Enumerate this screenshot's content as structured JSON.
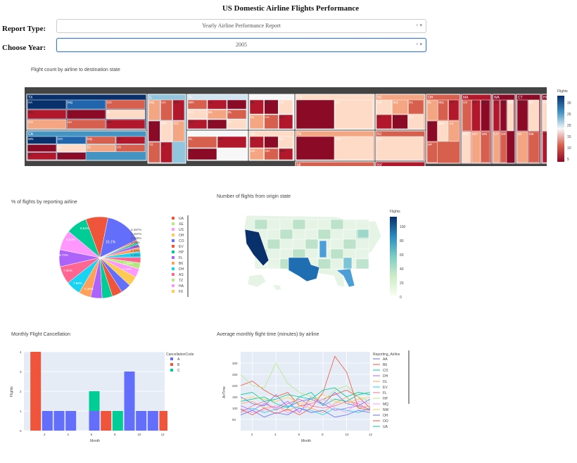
{
  "page": {
    "title": "US Domestic Airline Flights Performance"
  },
  "form": {
    "report_type_label": "Report Type:",
    "report_type_value": "Yearly Airline Performance Report",
    "choose_year_label": "Choose Year:",
    "choose_year_value": "2005",
    "clear_glyph": "×",
    "arrow_glyph": "▾"
  },
  "colors": {
    "accent": "#3a7fd5",
    "bar_a": "#636efa",
    "bar_b": "#ef553b",
    "bar_c": "#00cc96",
    "plot_bg": "#e5ecf6"
  },
  "icons": [
    "clear-icon",
    "chevron-down-icon"
  ],
  "chart_data": [
    {
      "type": "treemap",
      "title": "Flight count by airline to destination state",
      "colorbar_title": "Flights",
      "colorbar_ticks": [
        "30",
        "25",
        "20",
        "15",
        "10",
        "5"
      ],
      "nodes": [
        {
          "state": "TX",
          "airlines": [
            "AA",
            "MQ",
            "CO",
            "WN",
            "XE",
            "DL",
            "OO",
            "UA",
            "HP"
          ]
        },
        {
          "state": "CA",
          "airlines": [
            "WN",
            "OO",
            "MQ",
            "HP",
            "AA",
            "UA",
            "DL",
            "AS",
            "B6",
            "CO"
          ]
        },
        {
          "state": "IL",
          "airlines": [
            "MQ",
            "UA",
            "WN",
            "AA",
            "NW",
            "OO",
            "TZ",
            "FL"
          ]
        },
        {
          "state": "FL",
          "airlines": [
            "WN",
            "AA",
            "EV",
            "CO",
            "B6",
            "DL",
            "OH",
            "US",
            "FL"
          ]
        },
        {
          "state": "GA",
          "airlines": [
            "DL",
            "EV",
            "FL"
          ]
        },
        {
          "state": "NY",
          "airlines": [
            "B6",
            "MQ",
            "OH",
            "DL",
            "AA",
            "US"
          ]
        },
        {
          "state": "VA",
          "airlines": [
            "UA",
            "AA",
            "DL",
            "US",
            "OH",
            "NW"
          ]
        },
        {
          "state": "CO",
          "airlines": [
            "OO",
            "UA"
          ]
        },
        {
          "state": "PA",
          "airlines": [
            "US",
            "FW"
          ]
        },
        {
          "state": "MI",
          "airlines": [
            "NW",
            "OH"
          ]
        },
        {
          "state": "KY",
          "airlines": [
            "OH",
            "DL"
          ]
        },
        {
          "state": "NC",
          "airlines": [
            "US",
            "MQ",
            "DL",
            "EV",
            "OH",
            "AA"
          ]
        },
        {
          "state": "NJ",
          "airlines": [
            "CO"
          ]
        },
        {
          "state": "NV",
          "airlines": [
            "WN",
            "HP",
            "AA"
          ]
        },
        {
          "state": "UT",
          "airlines": [
            "DO",
            "WN",
            "EV",
            "DL"
          ]
        },
        {
          "state": "OH",
          "airlines": [
            "DL",
            "MQ",
            "TN",
            "NW",
            "WN",
            "AZ",
            "HP"
          ]
        },
        {
          "state": "MA",
          "airlines": [
            "US",
            "AA",
            "MN",
            "NW",
            "MO",
            "WN"
          ]
        },
        {
          "state": "WA",
          "airlines": [
            "AS",
            "WN",
            "MD",
            "LA",
            "OR"
          ]
        },
        {
          "state": "CT",
          "airlines": [
            "NM",
            "SC",
            "WI",
            "ME"
          ]
        },
        {
          "state": "HI",
          "airlines": [
            "HA",
            "AK",
            "NE",
            "IA",
            "MT"
          ]
        },
        {
          "state": "AL",
          "airlines": [
            "AR",
            "IN",
            "PR",
            "RI",
            "WY"
          ]
        }
      ]
    },
    {
      "type": "pie",
      "title": "% of flights by reporting airline",
      "labels": [
        "UA",
        "XE",
        "US",
        "OH",
        "CO",
        "EV",
        "HP",
        "FL",
        "B6",
        "DH",
        "AS",
        "TZ",
        "HA",
        "F9"
      ],
      "slice_labels": [
        "16.1%",
        "8.72%",
        "7.36%",
        "7.66%",
        "6.36%",
        "9.03%",
        "9.64%",
        "2.39%",
        "2.39%",
        "1.89%",
        "1.49%",
        "0.895%",
        "0.497%",
        "0.497%",
        "2.58%",
        "3.78%",
        "4.37%",
        "4.37%",
        "4.47%",
        "4.47%",
        "4.97%",
        "5.27%"
      ],
      "values": [
        16.1,
        0.497,
        0.497,
        0.895,
        1.49,
        1.89,
        2.39,
        2.39,
        2.58,
        3.78,
        4.37,
        4.37,
        4.47,
        4.47,
        4.97,
        5.27,
        6.36,
        7.66,
        7.36,
        8.72,
        9.03,
        9.64
      ]
    },
    {
      "type": "choropleth",
      "title": "Number of flights from origin state",
      "colorbar_title": "Flights",
      "colorbar_ticks": [
        "100",
        "80",
        "60",
        "40",
        "20",
        "0"
      ],
      "highlighted": {
        "CA": 100,
        "TX": 95,
        "IL": 55,
        "FL": 60,
        "GA": 40,
        "NY": 35
      }
    },
    {
      "type": "bar",
      "title": "Monthly Flight Cancellation",
      "xlabel": "Month",
      "ylabel": "Flights",
      "x_ticks": [
        "2",
        "4",
        "6",
        "8",
        "10",
        "12"
      ],
      "y_ticks": [
        "0",
        "1",
        "2",
        "3",
        "4"
      ],
      "ylim": [
        0,
        4
      ],
      "legend_title": "CancellationCode",
      "series": [
        {
          "name": "A",
          "values": [
            {
              "x": 2,
              "y": 1
            },
            {
              "x": 3,
              "y": 1
            },
            {
              "x": 4,
              "y": 1
            },
            {
              "x": 6,
              "y": 1
            },
            {
              "x": 9,
              "y": 3
            },
            {
              "x": 10,
              "y": 1
            },
            {
              "x": 11,
              "y": 1
            }
          ]
        },
        {
          "name": "B",
          "values": [
            {
              "x": 1,
              "y": 4
            },
            {
              "x": 7,
              "y": 1
            },
            {
              "x": 12,
              "y": 1
            }
          ]
        },
        {
          "name": "C",
          "values": [
            {
              "x": 6,
              "y": 1
            },
            {
              "x": 8,
              "y": 1
            }
          ]
        }
      ]
    },
    {
      "type": "line",
      "title": "Average monthly flight time (minutes) by airline",
      "xlabel": "Month",
      "ylabel": "AirTime",
      "x_ticks": [
        "2",
        "4",
        "6",
        "8",
        "10",
        "12"
      ],
      "y_ticks": [
        "300",
        "250",
        "200",
        "150",
        "100",
        "50"
      ],
      "legend_title": "Reporting_Airline",
      "series": [
        {
          "name": "AA",
          "values": [
            150,
            120,
            110,
            160,
            105,
            130,
            140,
            115,
            170,
            120,
            110,
            140
          ]
        },
        {
          "name": "B6",
          "values": [
            200,
            220,
            180,
            150,
            170,
            110,
            120,
            140,
            160,
            180,
            150,
            100
          ]
        },
        {
          "name": "CO",
          "values": [
            130,
            140,
            150,
            120,
            100,
            150,
            170,
            110,
            140,
            130,
            160,
            170
          ]
        },
        {
          "name": "DH",
          "values": [
            110,
            90,
            120,
            100,
            130,
            80,
            150,
            120,
            90,
            100,
            110,
            95
          ]
        },
        {
          "name": "DL",
          "values": [
            120,
            130,
            100,
            110,
            90,
            110,
            100,
            80,
            120,
            150,
            100,
            110
          ]
        },
        {
          "name": "EV",
          "values": [
            90,
            100,
            80,
            95,
            110,
            100,
            90,
            70,
            100,
            90,
            80,
            100
          ]
        },
        {
          "name": "FL",
          "values": [
            80,
            110,
            130,
            90,
            120,
            140,
            110,
            100,
            110,
            130,
            120,
            90
          ]
        },
        {
          "name": "HP",
          "values": [
            250,
            200,
            190,
            300,
            210,
            170,
            150,
            130,
            180,
            200,
            150,
            130
          ]
        },
        {
          "name": "MQ",
          "values": [
            100,
            80,
            90,
            110,
            80,
            90,
            120,
            140,
            100,
            80,
            130,
            120
          ]
        },
        {
          "name": "NW",
          "values": [
            140,
            150,
            140,
            130,
            150,
            120,
            130,
            160,
            130,
            120,
            140,
            150
          ]
        },
        {
          "name": "OH",
          "values": [
            70,
            90,
            60,
            80,
            70,
            100,
            80,
            90,
            60,
            70,
            90,
            80
          ]
        },
        {
          "name": "OO",
          "values": [
            95,
            70,
            100,
            75,
            95,
            70,
            100,
            170,
            330,
            260,
            100,
            90
          ]
        },
        {
          "name": "UA",
          "values": [
            160,
            170,
            130,
            140,
            160,
            150,
            140,
            180,
            190,
            150,
            170,
            160
          ]
        }
      ]
    }
  ]
}
